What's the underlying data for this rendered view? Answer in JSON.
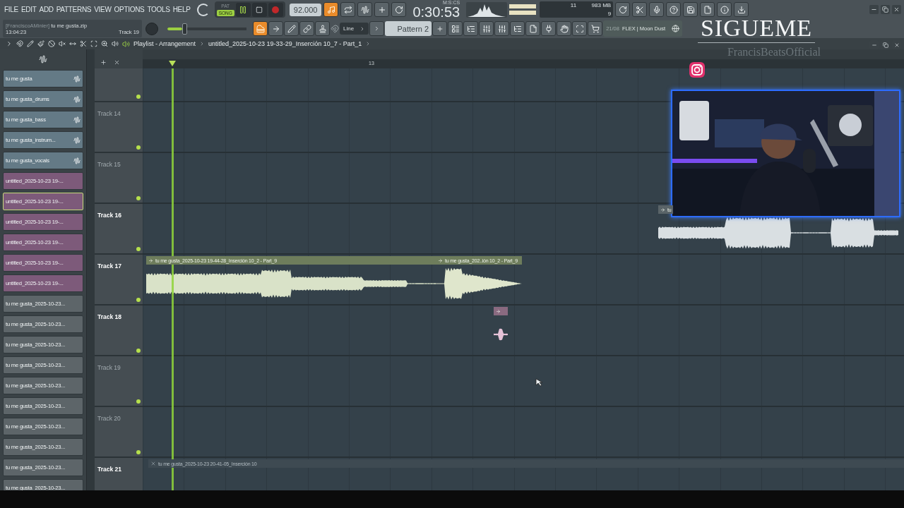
{
  "menu": [
    "FILE",
    "EDIT",
    "ADD",
    "PATTERNS",
    "VIEW",
    "OPTIONS",
    "TOOLS",
    "HELP"
  ],
  "hint": {
    "user": "[FranciscoAMinier]",
    "file": "tu me gusta.zip",
    "time": "13:04:23",
    "target": "Track 19"
  },
  "transport": {
    "modes": [
      {
        "label": "PAT",
        "selected": false
      },
      {
        "label": "SONG",
        "selected": true
      }
    ],
    "playing": true,
    "recording": false,
    "tempo": "92.000",
    "time": "0:30:53",
    "time_unit": "M:S:CS"
  },
  "monitor": {
    "cpu": "11",
    "memory": "983 MB",
    "polyphony": "9"
  },
  "master_volume": {
    "level": 0.2
  },
  "pattern_tools": [
    {
      "on": true
    },
    {
      "on": false
    },
    {
      "on": false
    },
    {
      "on": false
    },
    {
      "on": false
    }
  ],
  "edit_tools": [
    {
      "on": true
    },
    {
      "on": false
    },
    {
      "on": false
    },
    {
      "on": false
    },
    {
      "on": false
    }
  ],
  "snap": "Line",
  "pattern": "Pattern 2",
  "news": {
    "date": "21/08",
    "text": "FLEX | Moon Dust"
  },
  "playlist": {
    "title": "Playlist - Arrangement",
    "path": "untitled_2025-10-23 19-33-29_Inserción 10_7 - Part_1",
    "ruler": [
      "13"
    ]
  },
  "clip_list": [
    {
      "label": "tu me gusta",
      "kind": "pack",
      "color": "#647a86",
      "selected": false
    },
    {
      "label": "tu me gusta_drums",
      "kind": "pack",
      "color": "#647a86",
      "selected": false
    },
    {
      "label": "tu me gusta_bass",
      "kind": "pack",
      "color": "#647a86",
      "selected": false
    },
    {
      "label": "tu me gusta_instrum...",
      "kind": "pack",
      "color": "#647a86",
      "selected": false
    },
    {
      "label": "tu me gusta_vocals",
      "kind": "pack",
      "color": "#647a86",
      "selected": false
    },
    {
      "label": "untitled_2025-10-23 19-...",
      "kind": "audio",
      "color": "#7d5a7a",
      "selected": false
    },
    {
      "label": "untitled_2025-10-23 19-...",
      "kind": "audio",
      "color": "#7d5a7a",
      "selected": true
    },
    {
      "label": "untitled_2025-10-23 19-...",
      "kind": "audio",
      "color": "#7d5a7a",
      "selected": false
    },
    {
      "label": "untitled_2025-10-23 19-...",
      "kind": "audio",
      "color": "#7d5a7a",
      "selected": false
    },
    {
      "label": "untitled_2025-10-23 19-...",
      "kind": "audio",
      "color": "#7d5a7a",
      "selected": false
    },
    {
      "label": "untitled_2025-10-23 19-...",
      "kind": "audio",
      "color": "#7d5a7a",
      "selected": false
    },
    {
      "label": "tu me gusta_2025-10-23...",
      "kind": "audio",
      "color": "#5d6569",
      "selected": false
    },
    {
      "label": "tu me gusta_2025-10-23...",
      "kind": "audio",
      "color": "#5d6569",
      "selected": false
    },
    {
      "label": "tu me gusta_2025-10-23...",
      "kind": "audio",
      "color": "#5d6569",
      "selected": false
    },
    {
      "label": "tu me gusta_2025-10-23...",
      "kind": "audio",
      "color": "#5d6569",
      "selected": false
    },
    {
      "label": "tu me gusta_2025-10-23...",
      "kind": "audio",
      "color": "#5d6569",
      "selected": false
    },
    {
      "label": "tu me gusta_2025-10-23...",
      "kind": "audio",
      "color": "#5d6569",
      "selected": false
    },
    {
      "label": "tu me gusta_2025-10-23...",
      "kind": "audio",
      "color": "#5d6569",
      "selected": false
    },
    {
      "label": "tu me gusta_2025-10-23...",
      "kind": "audio",
      "color": "#5d6569",
      "selected": false
    },
    {
      "label": "tu me gusta_2025-10-23...",
      "kind": "audio",
      "color": "#5d6569",
      "selected": false
    },
    {
      "label": "tu me gusta_2025-10-23...",
      "kind": "audio",
      "color": "#5d6569",
      "selected": false
    }
  ],
  "tracks": [
    {
      "enabled": true
    },
    {
      "label": "Track 14",
      "enabled": true,
      "dimmed": true
    },
    {
      "label": "Track 15",
      "enabled": true,
      "dimmed": true
    },
    {
      "label": "Track 16",
      "enabled": true,
      "dimmed": false,
      "clips": [
        {
          "label": "tu",
          "color": "#5a6468",
          "muted": false
        }
      ]
    },
    {
      "label": "Track 17",
      "enabled": true,
      "dimmed": false,
      "clips": [
        {
          "label": "tu me gusta_2025-10-23 19-44-28_Inserción 10_2 - Part_9",
          "color": "#6e7d5c",
          "muted": false
        },
        {
          "label": "tu me gusta_202..ión 10_2 - Part_9",
          "color": "#6e7d5c",
          "muted": false
        }
      ]
    },
    {
      "label": "Track 18",
      "enabled": true,
      "dimmed": false,
      "clips": [
        {
          "color": "#8a6a80",
          "muted": false
        }
      ]
    },
    {
      "label": "Track 19",
      "enabled": true,
      "dimmed": true
    },
    {
      "label": "Track 20",
      "enabled": true,
      "dimmed": true
    },
    {
      "label": "Track 21",
      "dimmed": false,
      "clips": [
        {
          "label": "tu me gusta_2025-10-23 20-41-05_Inserción 10",
          "color": "#3e4a52",
          "muted": true
        }
      ]
    }
  ],
  "overlay": {
    "title": "SIGUEME",
    "handle": "FrancisBeatsOfficial"
  }
}
